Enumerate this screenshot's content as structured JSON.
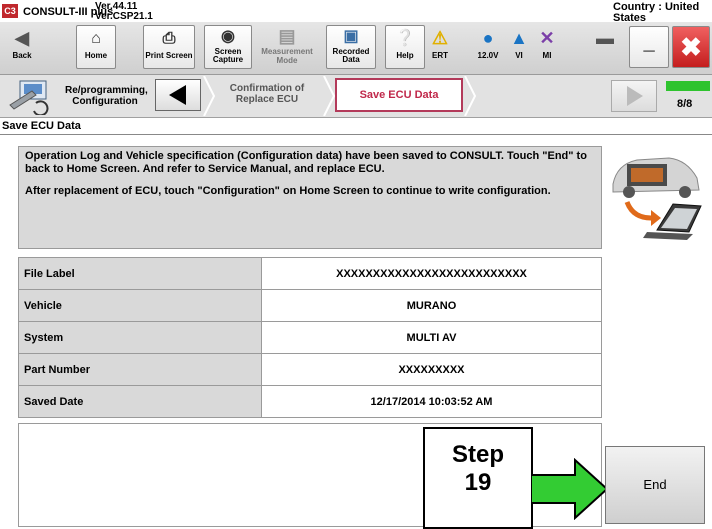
{
  "window": {
    "app_name": "CONSULT-III plus",
    "version_line1": "Ver.44.11",
    "version_line2": "Ver.CSP21.1",
    "country_label": "Country : United",
    "country_label_2": "States"
  },
  "toolbar": {
    "back": "Back",
    "home": "Home",
    "print_screen": "Print Screen",
    "screen_capture_1": "Screen",
    "screen_capture_2": "Capture",
    "measurement_1": "Measurement",
    "measurement_2": "Mode",
    "recorded_1": "Recorded",
    "recorded_2": "Data",
    "help": "Help",
    "ert": "ERT",
    "voltage": "12.0V",
    "vi": "VI",
    "mi": "MI"
  },
  "breadcrumb": {
    "step1_line1": "Re/programming,",
    "step1_line2": "Configuration",
    "step2_line1": "Confirmation of",
    "step2_line2": "Replace ECU",
    "step3": "Save ECU Data",
    "progress": "8/8"
  },
  "section_title": "Save ECU Data",
  "message": {
    "line1": "Operation Log and Vehicle specification (Configuration data) have been saved to CONSULT. Touch \"End\" to back to Home Screen. And refer to Service Manual, and replace ECU.",
    "line2": "After replacement of ECU, touch \"Configuration\" on Home Screen to continue to write configuration."
  },
  "rows": [
    {
      "label": "File Label",
      "value": "XXXXXXXXXXXXXXXXXXXXXXXXXX"
    },
    {
      "label": "Vehicle",
      "value": "MURANO"
    },
    {
      "label": "System",
      "value": "MULTI AV"
    },
    {
      "label": "Part Number",
      "value": "XXXXXXXXX"
    },
    {
      "label": "Saved Date",
      "value": "12/17/2014 10:03:52 AM"
    }
  ],
  "overlay": {
    "step_line1": "Step",
    "step_line2": "19",
    "arrow_color": "#33cc33"
  },
  "end_button": "End",
  "colors": {
    "logo": "#c0282d",
    "active_step": "#c0284a",
    "progress": "#2ec32e",
    "close": "#e02828"
  }
}
